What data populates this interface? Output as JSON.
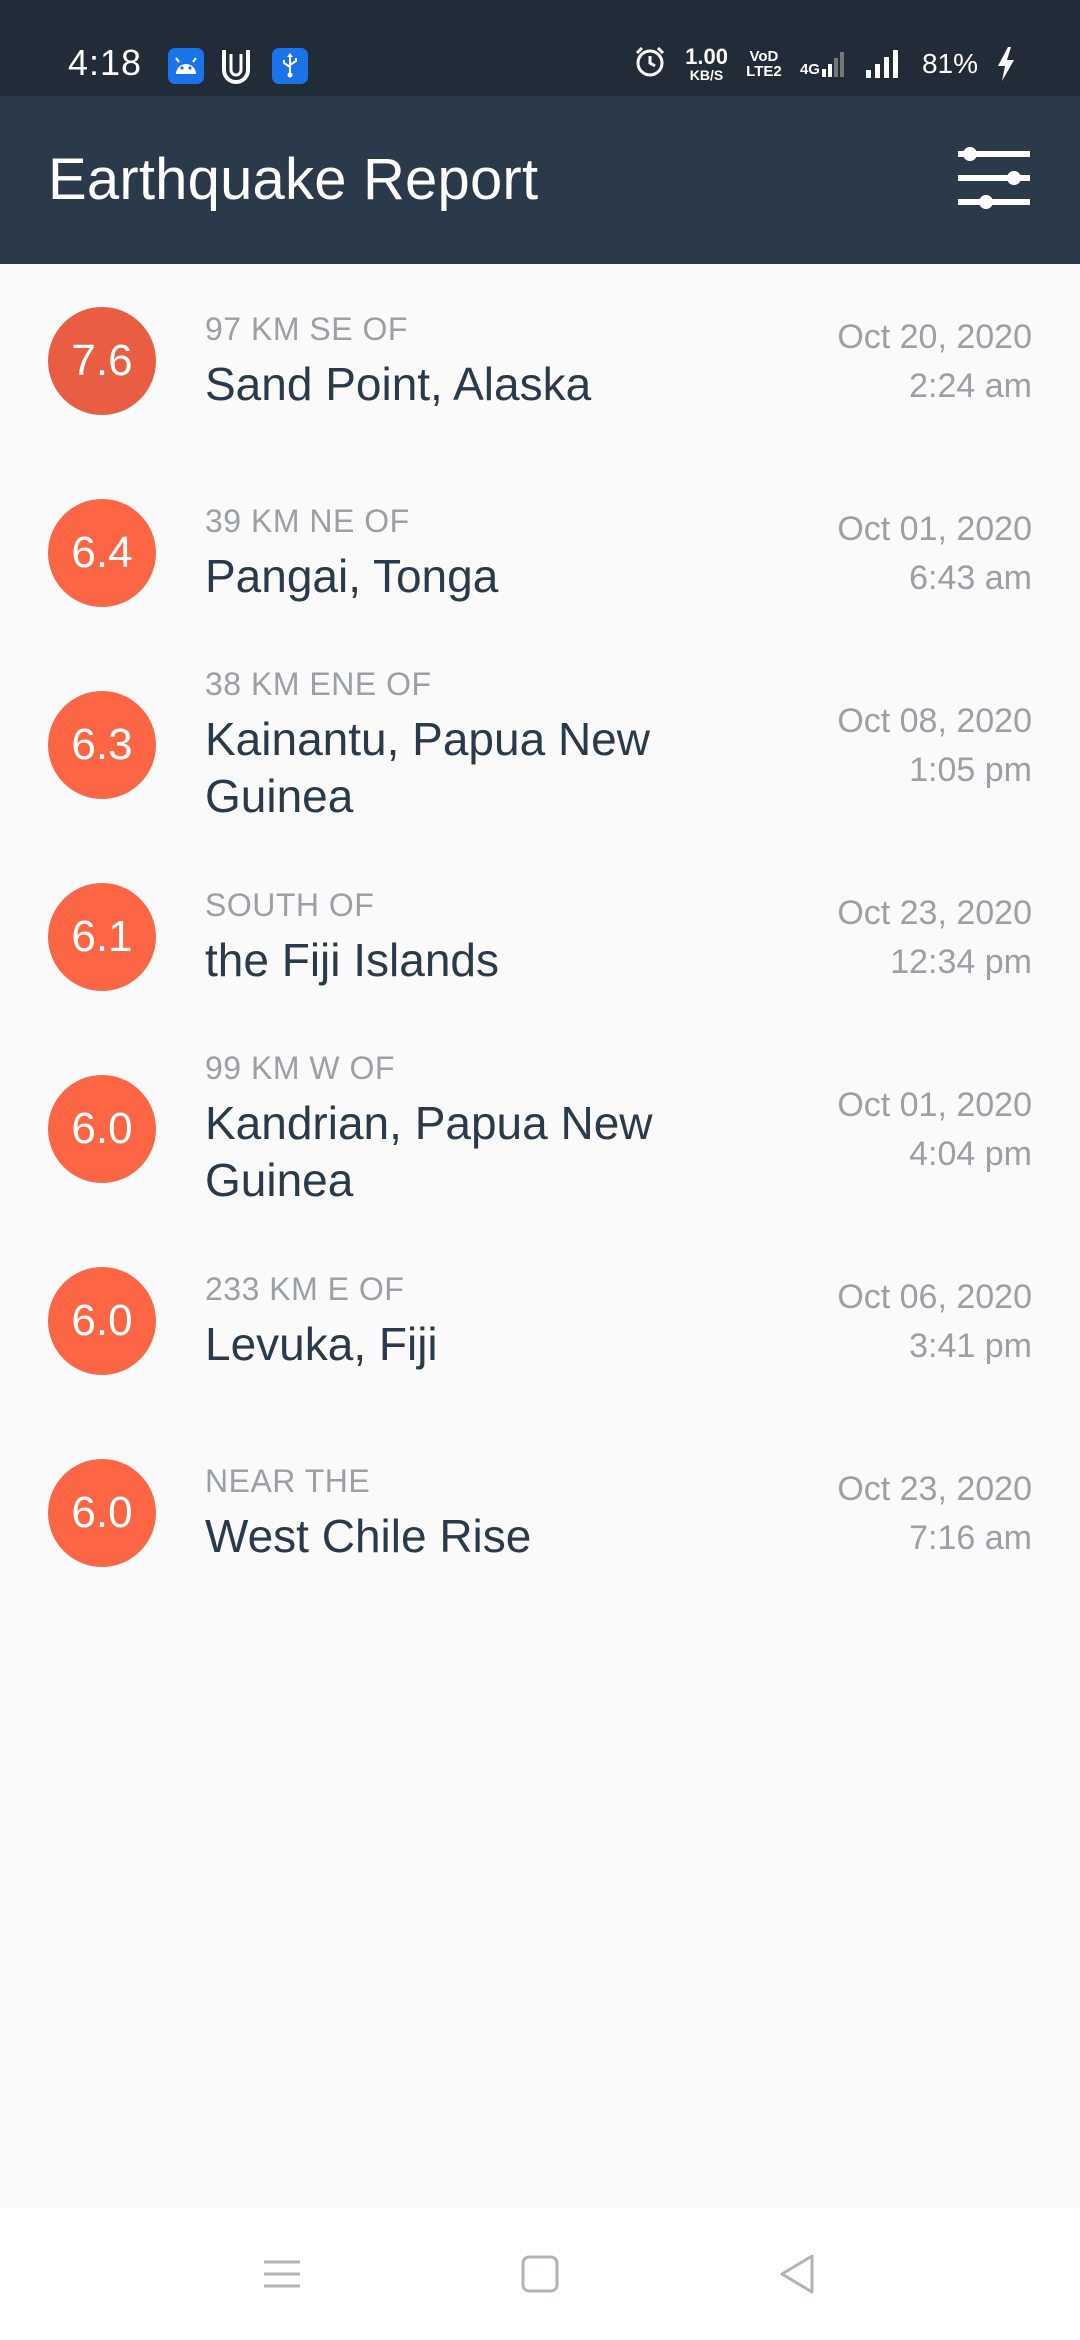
{
  "status_bar": {
    "time": "4:18",
    "net_speed_value": "1.00",
    "net_speed_unit": "KB/S",
    "volte": "VoD LTE2",
    "network": "4G",
    "battery": "81%",
    "icons": [
      "android-icon",
      "u-app-icon",
      "usb-icon",
      "alarm-icon",
      "signal-icon",
      "charging-icon"
    ]
  },
  "app_bar": {
    "title": "Earthquake Report",
    "filter_icon": "filter-sliders-icon"
  },
  "colors": {
    "status_bar_bg": "#222b38",
    "app_bar_bg": "#2b3a4a",
    "magnitude_high": "#e95d42",
    "magnitude": "#fc6644",
    "secondary_text": "#9aa0a6",
    "primary_text": "#2b3a4a"
  },
  "earthquakes": [
    {
      "magnitude": "7.6",
      "offset": "97 KM SE OF",
      "place": "Sand Point, Alaska",
      "date": "Oct 20, 2020",
      "time": "2:24 am"
    },
    {
      "magnitude": "6.4",
      "offset": "39 KM NE OF",
      "place": "Pangai, Tonga",
      "date": "Oct 01, 2020",
      "time": "6:43 am"
    },
    {
      "magnitude": "6.3",
      "offset": "38 KM ENE OF",
      "place": "Kainantu, Papua New Guinea",
      "date": "Oct 08, 2020",
      "time": "1:05 pm"
    },
    {
      "magnitude": "6.1",
      "offset": "SOUTH OF",
      "place": "the Fiji Islands",
      "date": "Oct 23, 2020",
      "time": "12:34 pm"
    },
    {
      "magnitude": "6.0",
      "offset": "99 KM W OF",
      "place": "Kandrian, Papua New Guinea",
      "date": "Oct 01, 2020",
      "time": "4:04 pm"
    },
    {
      "magnitude": "6.0",
      "offset": "233 KM E OF",
      "place": "Levuka, Fiji",
      "date": "Oct 06, 2020",
      "time": "3:41 pm"
    },
    {
      "magnitude": "6.0",
      "offset": "NEAR THE",
      "place": "West Chile Rise",
      "date": "Oct 23, 2020",
      "time": "7:16 am"
    }
  ],
  "nav_bar": {
    "buttons": [
      "menu-icon",
      "home-icon",
      "back-icon"
    ]
  }
}
